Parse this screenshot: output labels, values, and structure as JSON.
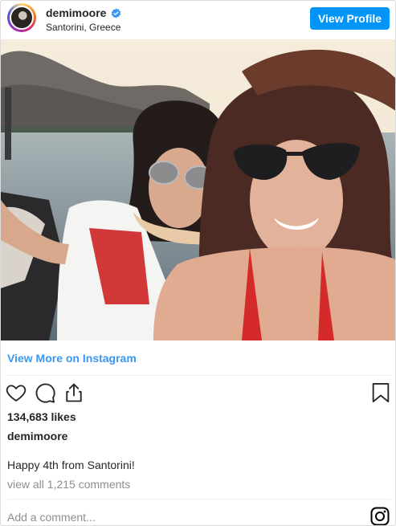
{
  "header": {
    "username": "demimoore",
    "verified": true,
    "location": "Santorini, Greece",
    "view_profile_label": "View Profile"
  },
  "post": {
    "view_more_label": "View More on Instagram",
    "likes": "134,683 likes",
    "caption_username": "demimoore",
    "caption_text": "Happy 4th from Santorini!",
    "comments_link": "view all 1,215 comments",
    "add_comment_placeholder": "Add a comment..."
  },
  "icons": {
    "like": "heart-icon",
    "comment": "comment-icon",
    "share": "share-icon",
    "save": "bookmark-icon",
    "verified": "verified-badge-icon",
    "brand": "instagram-icon"
  },
  "colors": {
    "accent": "#0095f6",
    "link": "#3897f0",
    "muted": "#8e8e8e",
    "text": "#262626",
    "divider": "#efefef"
  }
}
